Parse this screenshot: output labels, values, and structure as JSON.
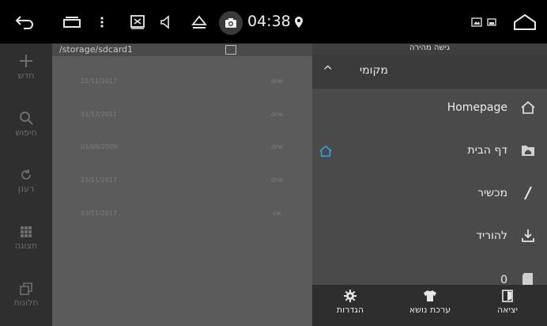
{
  "status_bar": {
    "time": "04:38",
    "icons": [
      "back-icon",
      "recent-apps-icon",
      "menu-dots-icon",
      "screenshot-icon",
      "volume-icon",
      "eject-icon",
      "camera-icon",
      "location-pin-icon",
      "gallery-icon",
      "picture-icon",
      "home-icon"
    ]
  },
  "sidebar": {
    "items": [
      {
        "label": "חדש",
        "icon": "plus-icon"
      },
      {
        "label": "חיפוש",
        "icon": "search-icon"
      },
      {
        "label": "רענן",
        "icon": "refresh-icon"
      },
      {
        "label": "תצוגה",
        "icon": "grid-icon"
      },
      {
        "label": "חלונות",
        "icon": "windows-icon"
      }
    ]
  },
  "files": {
    "path": "/storage/sdcard1",
    "rows": [
      {
        "date": "21/11/2017",
        "perm": "drw"
      },
      {
        "date": "31/12/2011",
        "perm": "drw"
      },
      {
        "date": "01/09/2009",
        "perm": "drw"
      },
      {
        "date": "21/11/2017",
        "perm": "drw"
      },
      {
        "date": "03/11/2017",
        "perm": "-rw"
      }
    ]
  },
  "panel": {
    "title": "גישה מהירה",
    "section": "מקומי",
    "items": [
      {
        "label": "Homepage",
        "icon": "home-outline-icon"
      },
      {
        "label": "דף הבית",
        "icon": "folder-home-icon"
      },
      {
        "label": "מכשיר",
        "icon": "slash-icon"
      },
      {
        "label": "להוריד",
        "icon": "download-icon"
      },
      {
        "label": "0",
        "icon": "sd-card-icon"
      }
    ],
    "toolbar": [
      {
        "label": "הגדרות",
        "icon": "settings-icon"
      },
      {
        "label": "ערכת נושא",
        "icon": "tshirt-icon"
      },
      {
        "label": "יציאה",
        "icon": "exit-icon"
      }
    ]
  },
  "colors": {
    "accent": "#2fa3e0"
  }
}
